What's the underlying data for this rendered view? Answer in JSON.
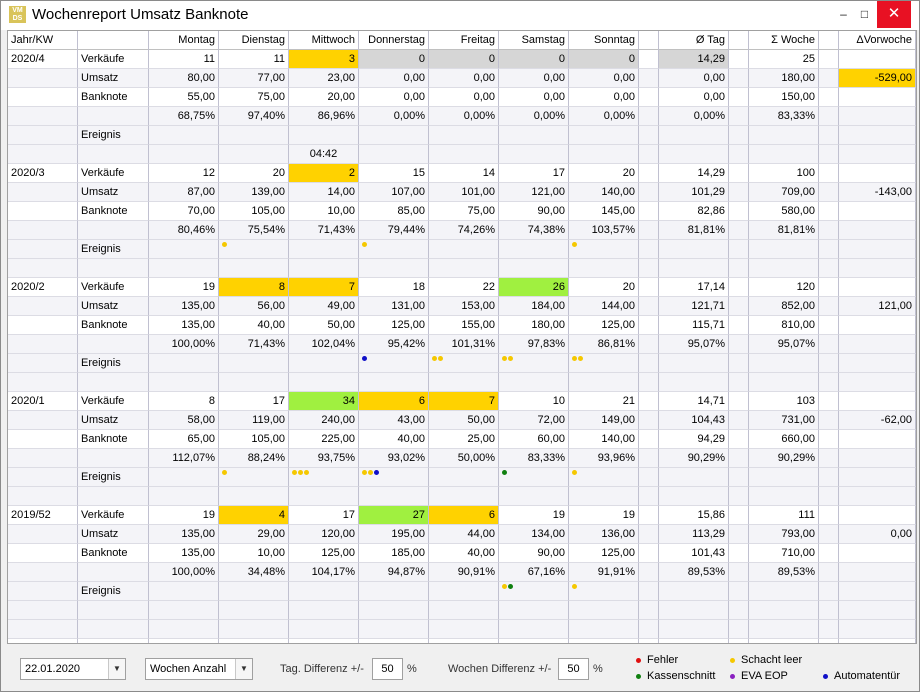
{
  "window": {
    "title": "Wochenreport Umsatz Banknote",
    "logo": "VM DS",
    "minimize": "–",
    "maximize": "□",
    "close": "✕"
  },
  "columns": [
    "Jahr/KW",
    "",
    "Montag",
    "Dienstag",
    "Mittwoch",
    "Donnerstag",
    "Freitag",
    "Samstag",
    "Sonntag",
    "",
    "Ø Tag",
    "",
    "Σ Woche",
    "",
    "ΔVorwoche"
  ],
  "colors": {
    "yellow": "#ffd200",
    "green": "#a0f040",
    "gray": "#d6d6d6",
    "red": "#e01010",
    "yellow_dot": "#f5c800",
    "green_dot": "#108010",
    "purple": "#8a20c0",
    "blue": "#1010c8"
  },
  "weeks": [
    {
      "kw": "2020/4",
      "rows": [
        {
          "label": "Verkäufe",
          "vals": [
            "11",
            "11",
            "3",
            "0",
            "0",
            "0",
            "0"
          ],
          "bg": [
            "",
            "",
            "yel",
            "gray",
            "gray",
            "gray",
            "gray"
          ],
          "avg": "14,29",
          "avg_bg": "gray",
          "sum": "25",
          "delta": ""
        },
        {
          "label": "Umsatz",
          "vals": [
            "80,00",
            "77,00",
            "23,00",
            "0,00",
            "0,00",
            "0,00",
            "0,00"
          ],
          "bg": [],
          "avg": "0,00",
          "sum": "180,00",
          "delta": "-529,00",
          "delta_bg": "yel"
        },
        {
          "label": "Banknote",
          "vals": [
            "55,00",
            "75,00",
            "20,00",
            "0,00",
            "0,00",
            "0,00",
            "0,00"
          ],
          "bg": [],
          "avg": "0,00",
          "sum": "150,00",
          "delta": ""
        },
        {
          "label": "",
          "vals": [
            "68,75%",
            "97,40%",
            "86,96%",
            "0,00%",
            "0,00%",
            "0,00%",
            "0,00%"
          ],
          "bg": [],
          "avg": "0,00%",
          "sum": "83,33%",
          "delta": ""
        },
        {
          "label": "Ereignis",
          "events": {
            "label": [
              "g"
            ]
          }
        },
        {
          "label": "",
          "vals": [
            "",
            "",
            "04:42",
            "",
            "",
            "",
            ""
          ],
          "center": true
        }
      ]
    },
    {
      "kw": "2020/3",
      "rows": [
        {
          "label": "Verkäufe",
          "vals": [
            "12",
            "20",
            "2",
            "15",
            "14",
            "17",
            "20"
          ],
          "bg": [
            "",
            "",
            "yel",
            "",
            "",
            "",
            ""
          ],
          "avg": "14,29",
          "sum": "100",
          "delta": ""
        },
        {
          "label": "Umsatz",
          "vals": [
            "87,00",
            "139,00",
            "14,00",
            "107,00",
            "101,00",
            "121,00",
            "140,00"
          ],
          "bg": [],
          "avg": "101,29",
          "sum": "709,00",
          "delta": "-143,00"
        },
        {
          "label": "Banknote",
          "vals": [
            "70,00",
            "105,00",
            "10,00",
            "85,00",
            "75,00",
            "90,00",
            "145,00"
          ],
          "bg": [],
          "avg": "82,86",
          "sum": "580,00",
          "delta": ""
        },
        {
          "label": "",
          "vals": [
            "80,46%",
            "75,54%",
            "71,43%",
            "79,44%",
            "74,26%",
            "74,38%",
            "103,57%"
          ],
          "bg": [],
          "avg": "81,81%",
          "sum": "81,81%",
          "delta": ""
        },
        {
          "label": "Ereignis",
          "events": {
            "label": [
              "g"
            ],
            "d1": [
              "y"
            ],
            "d3": [
              "y"
            ],
            "d6": [
              "y"
            ]
          }
        },
        {
          "label": "",
          "vals": []
        }
      ]
    },
    {
      "kw": "2020/2",
      "rows": [
        {
          "label": "Verkäufe",
          "vals": [
            "19",
            "8",
            "7",
            "18",
            "22",
            "26",
            "20"
          ],
          "bg": [
            "",
            "yel",
            "yel",
            "",
            "",
            "grn",
            ""
          ],
          "avg": "17,14",
          "sum": "120",
          "delta": ""
        },
        {
          "label": "Umsatz",
          "vals": [
            "135,00",
            "56,00",
            "49,00",
            "131,00",
            "153,00",
            "184,00",
            "144,00"
          ],
          "bg": [],
          "avg": "121,71",
          "sum": "852,00",
          "delta": "121,00"
        },
        {
          "label": "Banknote",
          "vals": [
            "135,00",
            "40,00",
            "50,00",
            "125,00",
            "155,00",
            "180,00",
            "125,00"
          ],
          "bg": [],
          "avg": "115,71",
          "sum": "810,00",
          "delta": ""
        },
        {
          "label": "",
          "vals": [
            "100,00%",
            "71,43%",
            "102,04%",
            "95,42%",
            "101,31%",
            "97,83%",
            "86,81%"
          ],
          "bg": [],
          "avg": "95,07%",
          "sum": "95,07%",
          "delta": ""
        },
        {
          "label": "Ereignis",
          "events": {
            "d3": [
              "b"
            ],
            "d4": [
              "y",
              "y"
            ],
            "d5": [
              "y",
              "y"
            ],
            "d6": [
              "y",
              "y"
            ]
          }
        },
        {
          "label": "",
          "vals": []
        }
      ]
    },
    {
      "kw": "2020/1",
      "rows": [
        {
          "label": "Verkäufe",
          "vals": [
            "8",
            "17",
            "34",
            "6",
            "7",
            "10",
            "21"
          ],
          "bg": [
            "",
            "",
            "grn",
            "yel",
            "yel",
            "",
            ""
          ],
          "avg": "14,71",
          "sum": "103",
          "delta": ""
        },
        {
          "label": "Umsatz",
          "vals": [
            "58,00",
            "119,00",
            "240,00",
            "43,00",
            "50,00",
            "72,00",
            "149,00"
          ],
          "bg": [],
          "avg": "104,43",
          "sum": "731,00",
          "delta": "-62,00"
        },
        {
          "label": "Banknote",
          "vals": [
            "65,00",
            "105,00",
            "225,00",
            "40,00",
            "25,00",
            "60,00",
            "140,00"
          ],
          "bg": [],
          "avg": "94,29",
          "sum": "660,00",
          "delta": ""
        },
        {
          "label": "",
          "vals": [
            "112,07%",
            "88,24%",
            "93,75%",
            "93,02%",
            "50,00%",
            "83,33%",
            "93,96%"
          ],
          "bg": [],
          "avg": "90,29%",
          "sum": "90,29%",
          "delta": ""
        },
        {
          "label": "Ereignis",
          "events": {
            "d1": [
              "y"
            ],
            "d2": [
              "y",
              "y",
              "y"
            ],
            "d3": [
              "y",
              "y",
              "b"
            ],
            "d5": [
              "g"
            ],
            "d6": [
              "y"
            ]
          }
        },
        {
          "label": "",
          "vals": []
        }
      ]
    },
    {
      "kw": "2019/52",
      "rows": [
        {
          "label": "Verkäufe",
          "vals": [
            "19",
            "4",
            "17",
            "27",
            "6",
            "19",
            "19"
          ],
          "bg": [
            "",
            "yel",
            "",
            "grn",
            "yel",
            "",
            ""
          ],
          "avg": "15,86",
          "sum": "111",
          "delta": ""
        },
        {
          "label": "Umsatz",
          "vals": [
            "135,00",
            "29,00",
            "120,00",
            "195,00",
            "44,00",
            "134,00",
            "136,00"
          ],
          "bg": [],
          "avg": "113,29",
          "sum": "793,00",
          "delta": "0,00"
        },
        {
          "label": "Banknote",
          "vals": [
            "135,00",
            "10,00",
            "125,00",
            "185,00",
            "40,00",
            "90,00",
            "125,00"
          ],
          "bg": [],
          "avg": "101,43",
          "sum": "710,00",
          "delta": ""
        },
        {
          "label": "",
          "vals": [
            "100,00%",
            "34,48%",
            "104,17%",
            "94,87%",
            "90,91%",
            "67,16%",
            "91,91%"
          ],
          "bg": [],
          "avg": "89,53%",
          "sum": "89,53%",
          "delta": ""
        },
        {
          "label": "Ereignis",
          "events": {
            "d5": [
              "y",
              "g"
            ],
            "d6": [
              "y"
            ]
          }
        },
        {
          "label": "",
          "vals": []
        }
      ]
    }
  ],
  "footer": {
    "date": "22.01.2020",
    "mode": "Wochen Anzahl",
    "tag_label": "Tag. Differenz +/-",
    "tag_value": "50",
    "woche_label": "Wochen Differenz +/-",
    "woche_value": "50",
    "percent": "%"
  },
  "legend": [
    {
      "label": "Fehler",
      "color": "red"
    },
    {
      "label": "Schacht leer",
      "color": "yellow_dot"
    },
    {
      "label": "Kassenschnitt",
      "color": "green_dot"
    },
    {
      "label": "EVA EOP",
      "color": "purple"
    },
    {
      "label": "Automatentür",
      "color": "blue"
    }
  ]
}
